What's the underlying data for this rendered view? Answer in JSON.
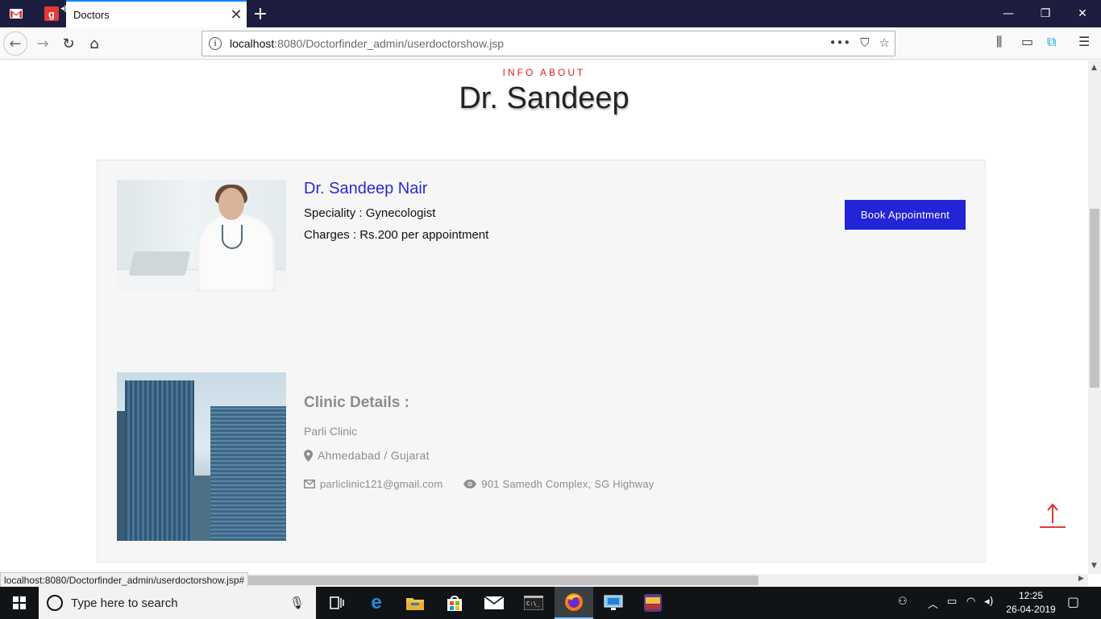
{
  "browser": {
    "tab_title": "Doctors",
    "gmail_pin_icon": "gmail-icon",
    "pinned_letter": "g",
    "url_host": "localhost",
    "url_rest": ":8080/Doctorfinder_admin/userdoctorshow.jsp",
    "status_url": "localhost:8080/Doctorfinder_admin/userdoctorshow.jsp#"
  },
  "page": {
    "kicker": "INFO ABOUT",
    "heading": "Dr. Sandeep"
  },
  "doctor": {
    "name": "Dr. Sandeep Nair",
    "speciality": "Speciality : Gynecologist",
    "charges": "Charges : Rs.200 per appointment",
    "book_label": "Book Appointment"
  },
  "clinic": {
    "section_title": "Clinic Details :",
    "name": "Parli Clinic",
    "location": "Ahmedabad / Gujarat",
    "email": "parliclinic121@gmail.com",
    "address": "901 Samedh Complex, SG Highway"
  },
  "taskbar": {
    "search_placeholder": "Type here to search",
    "time": "12:25",
    "date": "26-04-2019"
  },
  "colors": {
    "accent_red": "#e02020",
    "doctor_name_blue": "#2a2ad0",
    "button_blue": "#2323d8",
    "tab_bar": "#1d1d3f"
  }
}
